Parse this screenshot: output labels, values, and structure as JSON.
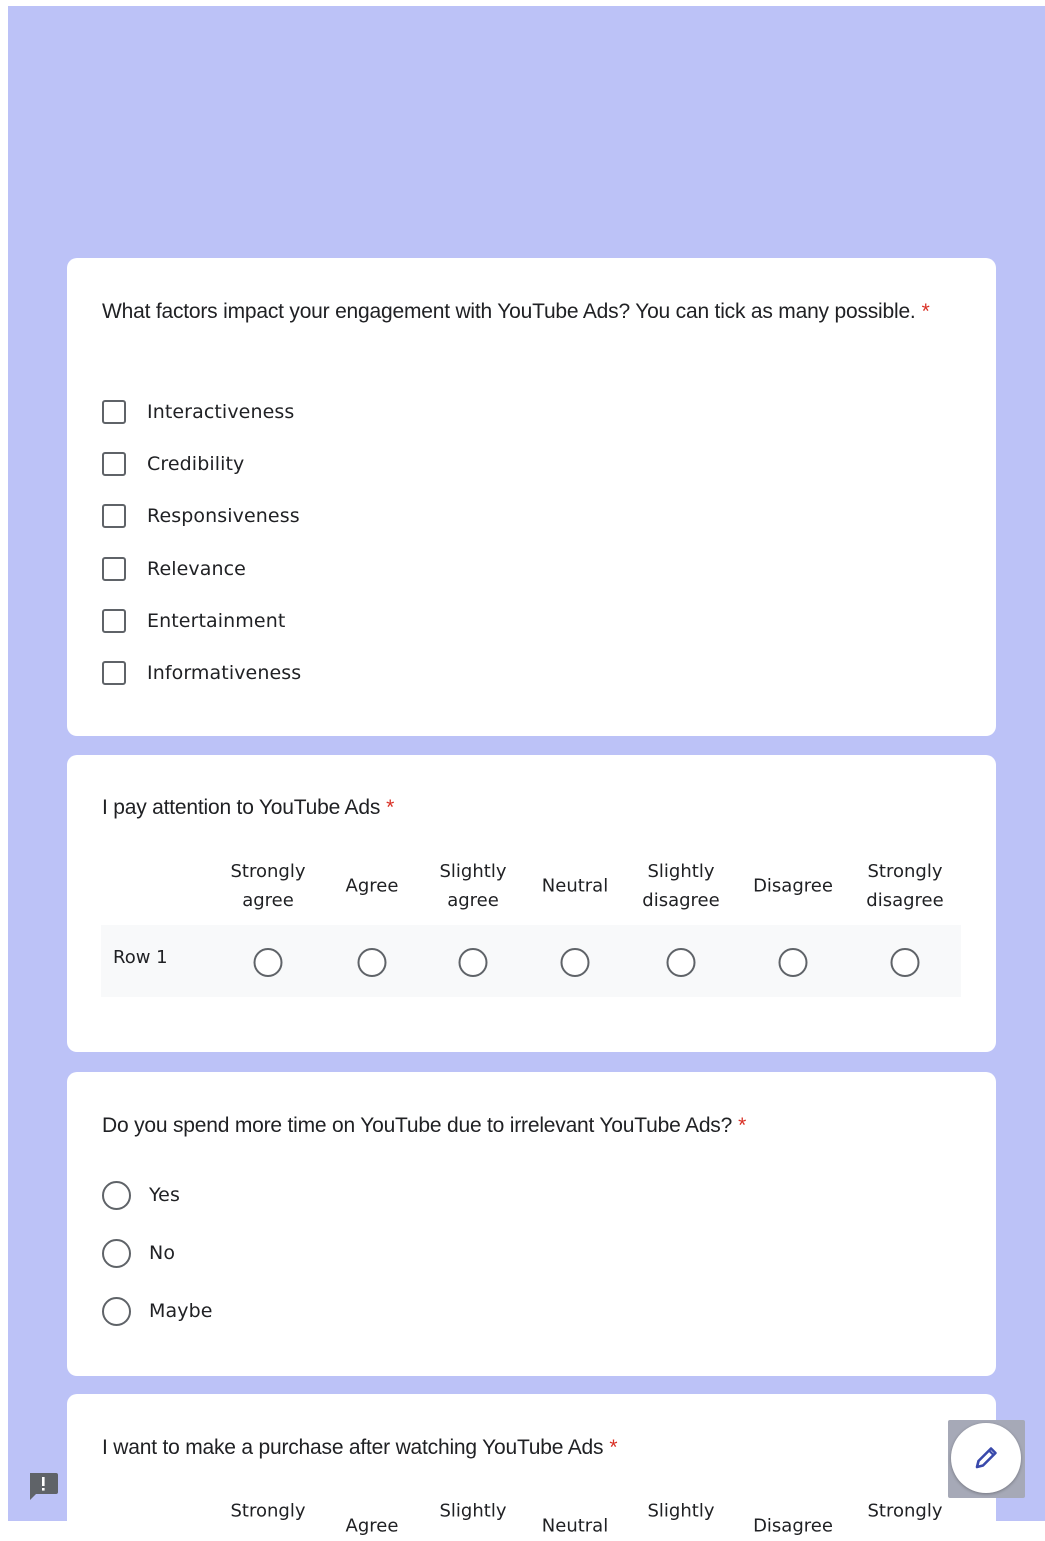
{
  "required_marker": "*",
  "q1": {
    "title": "What factors impact your engagement with YouTube Ads? You can tick as many possible.",
    "options": [
      {
        "label": "Interactiveness",
        "checked": false
      },
      {
        "label": "Credibility",
        "checked": false
      },
      {
        "label": "Responsiveness",
        "checked": false
      },
      {
        "label": "Relevance",
        "checked": false
      },
      {
        "label": "Entertainment",
        "checked": false
      },
      {
        "label": "Informativeness",
        "checked": false
      }
    ]
  },
  "q2": {
    "title": "I pay attention to YouTube Ads",
    "columns": [
      {
        "line1": "Strongly",
        "line2": "agree"
      },
      {
        "line1": "Agree",
        "line2": ""
      },
      {
        "line1": "Slightly",
        "line2": "agree"
      },
      {
        "line1": "Neutral",
        "line2": ""
      },
      {
        "line1": "Slightly",
        "line2": "disagree"
      },
      {
        "line1": "Disagree",
        "line2": ""
      },
      {
        "line1": "Strongly",
        "line2": "disagree"
      }
    ],
    "row_label": "Row 1"
  },
  "q3": {
    "title": "Do you spend more time on YouTube due to irrelevant YouTube Ads?",
    "options": [
      {
        "label": "Yes",
        "selected": false
      },
      {
        "label": "No",
        "selected": false
      },
      {
        "label": "Maybe",
        "selected": false
      }
    ]
  },
  "q4": {
    "title": "I want to make a purchase after watching YouTube Ads",
    "columns": [
      {
        "line1": "Strongly"
      },
      {
        "line1": "Agree"
      },
      {
        "line1": "Slightly"
      },
      {
        "line1": "Neutral"
      },
      {
        "line1": "Slightly"
      },
      {
        "line1": "Disagree"
      },
      {
        "line1": "Strongly"
      }
    ]
  },
  "colors": {
    "header_background": "#bcc2f7",
    "required": "#d93025",
    "accent": "#3949ab"
  },
  "icons": {
    "feedback": "report-issue-icon",
    "edit": "pencil-icon"
  }
}
